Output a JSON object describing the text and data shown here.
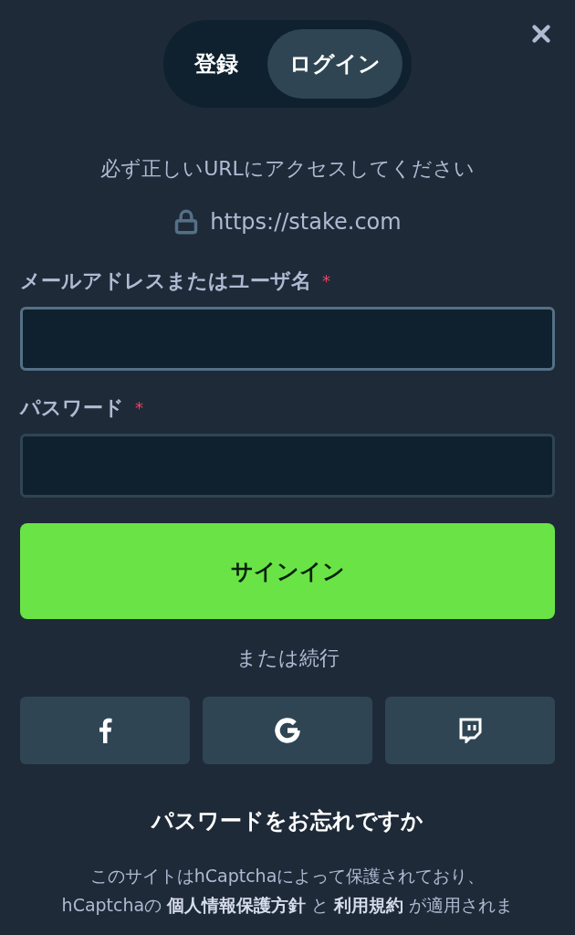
{
  "tabs": [
    {
      "label": "登録",
      "selected": false
    },
    {
      "label": "ログイン",
      "selected": true
    }
  ],
  "notice": "必ず正しいURLにアクセスしてください",
  "url": "https://stake.com",
  "fields": [
    {
      "label": "メールアドレスまたはユーザ名",
      "required_mark": "*",
      "kind": "text"
    },
    {
      "label": "パスワード",
      "required_mark": "*",
      "kind": "password"
    }
  ],
  "submit": "サインイン",
  "divider_text": "または続行",
  "social": [
    {
      "kind": "facebook"
    },
    {
      "kind": "google"
    },
    {
      "kind": "twitch"
    }
  ],
  "forgot": "パスワードをお忘れですか",
  "legal": {
    "line1": "このサイトはhCaptchaによって保護されており、",
    "prefix": "hCaptchaの",
    "links": [
      "個人情報保護方針",
      "利用規約"
    ],
    "joiner": "と",
    "suffix": "が適用されま"
  }
}
